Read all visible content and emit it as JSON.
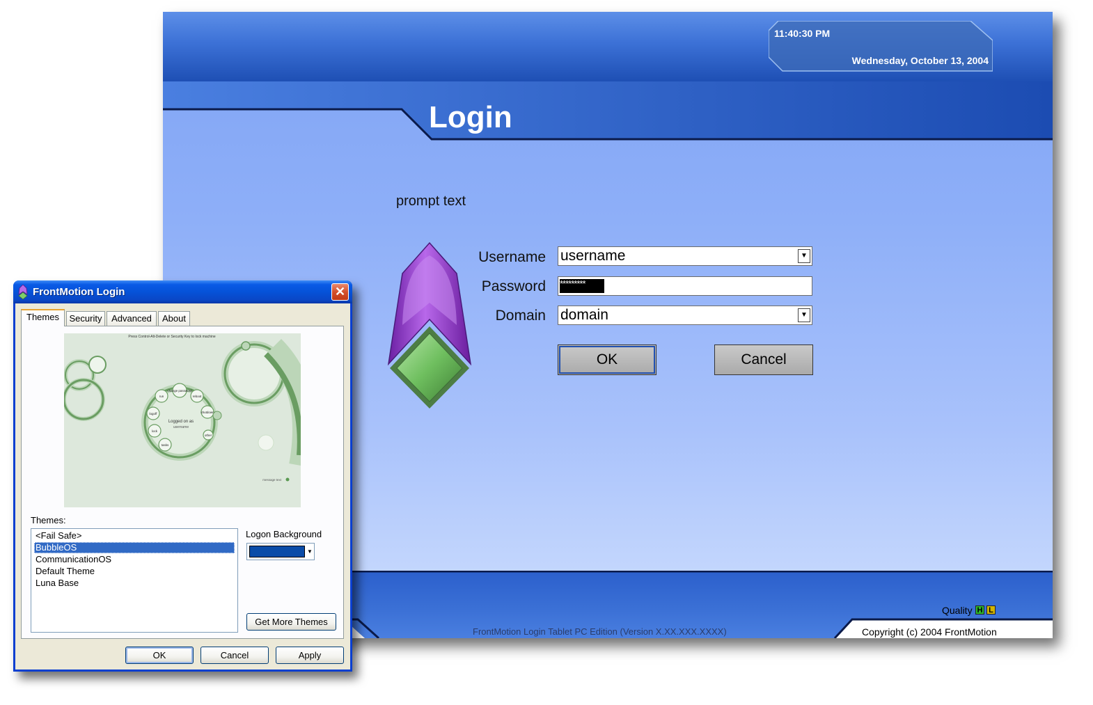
{
  "login_screen": {
    "clock": {
      "time": "11:40:30 PM",
      "date": "Wednesday, October 13, 2004"
    },
    "title": "Login",
    "prompt": "prompt text",
    "fields": {
      "username_label": "Username",
      "username_value": "username",
      "password_label": "Password",
      "password_value": "*********",
      "domain_label": "Domain",
      "domain_value": "domain"
    },
    "buttons": {
      "ok": "OK",
      "cancel": "Cancel"
    },
    "footer": {
      "quality_label": "Quality",
      "quality_high": "H",
      "quality_low": "L",
      "version": "FrontMotion Login Tablet PC Edition (Version X.XX.XXX.XXXX)",
      "copyright": "Copyright (c) 2004 FrontMotion"
    },
    "colors": {
      "band_dark": "#1e4fb4",
      "accent_line": "#0a1a4a"
    },
    "icons": {
      "logo": "purple-green-gem-icon",
      "dropdown": "chevron-down-icon"
    }
  },
  "dialog": {
    "title": "FrontMotion Login",
    "tabs": [
      {
        "label": "Themes",
        "active": true
      },
      {
        "label": "Security",
        "active": false
      },
      {
        "label": "Advanced",
        "active": false
      },
      {
        "label": "About",
        "active": false
      }
    ],
    "preview": {
      "header": "Press Control-Alt-Delete or Security Key to lock machine",
      "center_title": "Logged on as",
      "center_user": "username",
      "bubbles": [
        "lock",
        "logoff",
        "tasks",
        "run",
        "change password",
        "reboot",
        "shutdown",
        "other"
      ],
      "message": "message text"
    },
    "themes_label": "Themes:",
    "themes": [
      "<Fail Safe>",
      "BubbleOS",
      "CommunicationOS",
      "Default Theme",
      "Luna Base"
    ],
    "selected_theme": "BubbleOS",
    "logon_background_label": "Logon Background",
    "logon_background_color": "#0a4ca8",
    "get_more_button": "Get More Themes",
    "buttons": {
      "ok": "OK",
      "cancel": "Cancel",
      "apply": "Apply"
    },
    "icons": {
      "app": "frontmotion-app-icon",
      "close": "close-icon"
    }
  }
}
